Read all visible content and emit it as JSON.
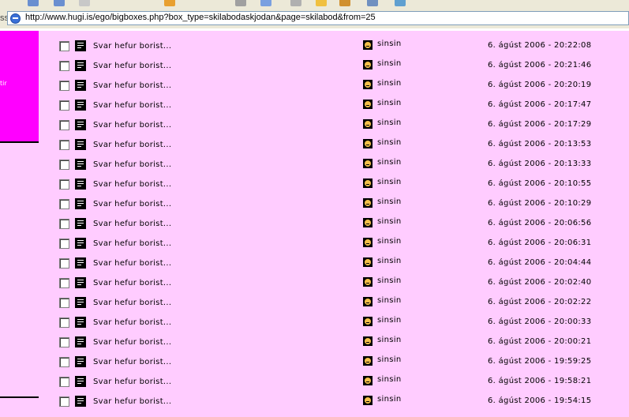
{
  "address_bar": {
    "label_fragment": "ss",
    "url": "http://www.hugi.is/ego/bigboxes.php?box_type=skilabodaskjodan&page=skilabod&from=25"
  },
  "sidebar": {
    "text_fragment": "tir",
    "box_color": "#ff00ff"
  },
  "colors": {
    "page_background": "#ffccff",
    "sidebar_accent": "#ff00ff"
  },
  "messages": [
    {
      "subject": "Svar hefur borist...",
      "user": "sinsin",
      "date": "6. ágúst 2006 - 20:22:08"
    },
    {
      "subject": "Svar hefur borist...",
      "user": "sinsin",
      "date": "6. ágúst 2006 - 20:21:46"
    },
    {
      "subject": "Svar hefur borist...",
      "user": "sinsin",
      "date": "6. ágúst 2006 - 20:20:19"
    },
    {
      "subject": "Svar hefur borist...",
      "user": "sinsin",
      "date": "6. ágúst 2006 - 20:17:47"
    },
    {
      "subject": "Svar hefur borist...",
      "user": "sinsin",
      "date": "6. ágúst 2006 - 20:17:29"
    },
    {
      "subject": "Svar hefur borist...",
      "user": "sinsin",
      "date": "6. ágúst 2006 - 20:13:53"
    },
    {
      "subject": "Svar hefur borist...",
      "user": "sinsin",
      "date": "6. ágúst 2006 - 20:13:33"
    },
    {
      "subject": "Svar hefur borist...",
      "user": "sinsin",
      "date": "6. ágúst 2006 - 20:10:55"
    },
    {
      "subject": "Svar hefur borist...",
      "user": "sinsin",
      "date": "6. ágúst 2006 - 20:10:29"
    },
    {
      "subject": "Svar hefur borist...",
      "user": "sinsin",
      "date": "6. ágúst 2006 - 20:06:56"
    },
    {
      "subject": "Svar hefur borist...",
      "user": "sinsin",
      "date": "6. ágúst 2006 - 20:06:31"
    },
    {
      "subject": "Svar hefur borist...",
      "user": "sinsin",
      "date": "6. ágúst 2006 - 20:04:44"
    },
    {
      "subject": "Svar hefur borist...",
      "user": "sinsin",
      "date": "6. ágúst 2006 - 20:02:40"
    },
    {
      "subject": "Svar hefur borist...",
      "user": "sinsin",
      "date": "6. ágúst 2006 - 20:02:22"
    },
    {
      "subject": "Svar hefur borist...",
      "user": "sinsin",
      "date": "6. ágúst 2006 - 20:00:33"
    },
    {
      "subject": "Svar hefur borist...",
      "user": "sinsin",
      "date": "6. ágúst 2006 - 20:00:21"
    },
    {
      "subject": "Svar hefur borist...",
      "user": "sinsin",
      "date": "6. ágúst 2006 - 19:59:25"
    },
    {
      "subject": "Svar hefur borist...",
      "user": "sinsin",
      "date": "6. ágúst 2006 - 19:58:21"
    },
    {
      "subject": "Svar hefur borist...",
      "user": "sinsin",
      "date": "6. ágúst 2006 - 19:54:15"
    }
  ]
}
